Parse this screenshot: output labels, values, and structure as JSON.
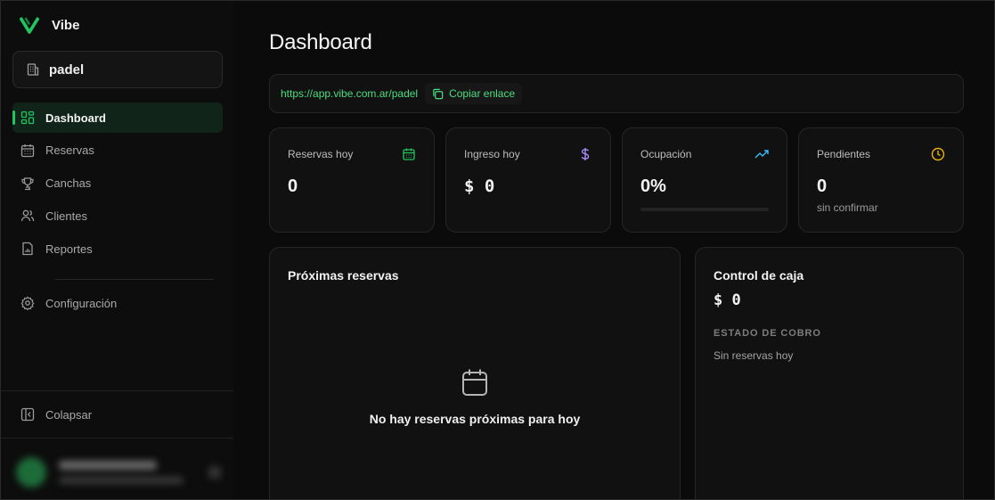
{
  "brand": {
    "name": "Vibe",
    "accent": "#22c55e"
  },
  "workspace": {
    "name": "padel",
    "icon": "building-icon"
  },
  "nav": {
    "items": [
      {
        "label": "Dashboard",
        "icon": "layout-grid-icon",
        "active": true
      },
      {
        "label": "Reservas",
        "icon": "calendar-icon"
      },
      {
        "label": "Canchas",
        "icon": "trophy-icon"
      },
      {
        "label": "Clientes",
        "icon": "users-icon"
      },
      {
        "label": "Reportes",
        "icon": "report-file-icon"
      }
    ],
    "settings": {
      "label": "Configuración",
      "icon": "gear-icon"
    },
    "collapse": {
      "label": "Colapsar",
      "icon": "panel-left-icon"
    }
  },
  "page": {
    "title": "Dashboard"
  },
  "share": {
    "url": "https://app.vibe.com.ar/padel",
    "copy_label": "Copiar enlace"
  },
  "stats": [
    {
      "label": "Reservas hoy",
      "value": "0",
      "icon": "calendar-icon",
      "color": "#22c55e"
    },
    {
      "label": "Ingreso hoy",
      "value": "$ 0",
      "icon": "dollar-icon",
      "color": "#a78bfa"
    },
    {
      "label": "Ocupación",
      "value": "0%",
      "icon": "trending-up-icon",
      "color": "#38bdf8",
      "progress": 0
    },
    {
      "label": "Pendientes",
      "value": "0",
      "sub": "sin confirmar",
      "icon": "clock-icon",
      "color": "#eab308"
    }
  ],
  "upcoming": {
    "title": "Próximas reservas",
    "empty_text": "No hay reservas próximas para hoy"
  },
  "cash": {
    "title": "Control de caja",
    "value": "$ 0",
    "status_caption": "ESTADO DE COBRO",
    "status_text": "Sin reservas hoy"
  }
}
